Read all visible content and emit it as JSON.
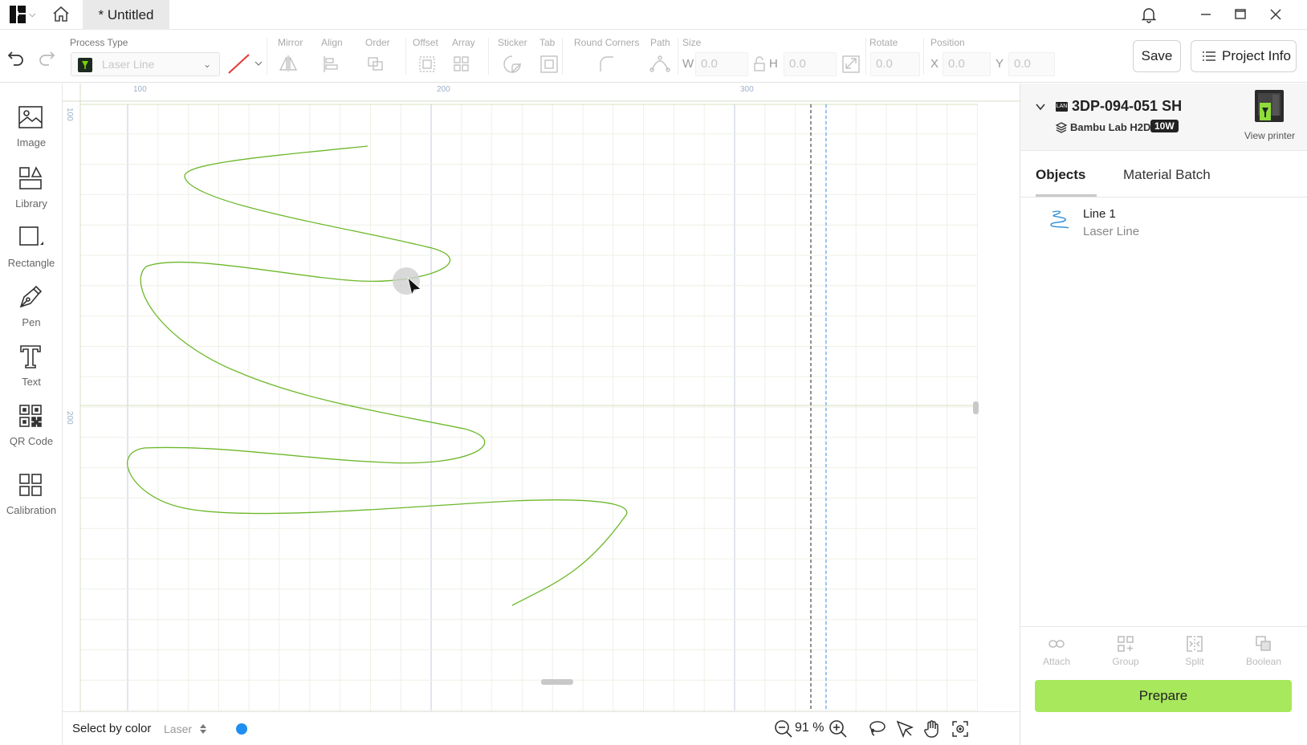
{
  "window": {
    "doc_tab_title": "* Untitled"
  },
  "toolbar": {
    "process_type_label": "Process Type",
    "process_type_value": "Laser Line",
    "mirror_label": "Mirror",
    "align_label": "Align",
    "order_label": "Order",
    "offset_label": "Offset",
    "array_label": "Array",
    "sticker_label": "Sticker",
    "tab_label": "Tab",
    "round_corners_label": "Round Corners",
    "path_label": "Path",
    "size_label": "Size",
    "size_w_axis": "W",
    "size_w": "0.0",
    "size_h_axis": "H",
    "size_h": "0.0",
    "rotate_label": "Rotate",
    "rotate_value": "0.0",
    "position_label": "Position",
    "pos_x_axis": "X",
    "pos_x": "0.0",
    "pos_y_axis": "Y",
    "pos_y": "0.0",
    "save_label": "Save",
    "project_info_label": "Project Info"
  },
  "tools": [
    {
      "label": "Image",
      "icon": "image-icon"
    },
    {
      "label": "Library",
      "icon": "library-icon"
    },
    {
      "label": "Rectangle",
      "icon": "rectangle-icon"
    },
    {
      "label": "Pen",
      "icon": "pen-icon"
    },
    {
      "label": "Text",
      "icon": "text-icon"
    },
    {
      "label": "QR Code",
      "icon": "qr-code-icon"
    },
    {
      "label": "Calibration",
      "icon": "calibration-icon"
    }
  ],
  "canvas": {
    "ruler_top": [
      "100",
      "200",
      "300"
    ],
    "ruler_left": [
      "100",
      "200"
    ],
    "line_color": "#6cb82a"
  },
  "bottombar": {
    "select_by_color_label": "Select by color",
    "layer_value": "Laser",
    "layer_color": "#1e8ff0",
    "zoom_value": "91 %"
  },
  "printer": {
    "connection_badge": "LAN",
    "name": "3DP-094-051 SH",
    "model": "Bambu Lab H2D",
    "laser_power": "10W",
    "view_printer_label": "View printer"
  },
  "panel": {
    "tab_objects": "Objects",
    "tab_material_batch": "Material Batch",
    "objects": [
      {
        "name": "Line 1",
        "type": "Laser Line"
      }
    ],
    "actions": [
      {
        "label": "Attach",
        "icon": "attach-icon"
      },
      {
        "label": "Group",
        "icon": "group-icon"
      },
      {
        "label": "Split",
        "icon": "split-icon"
      },
      {
        "label": "Boolean",
        "icon": "boolean-icon"
      }
    ],
    "prepare_label": "Prepare"
  }
}
